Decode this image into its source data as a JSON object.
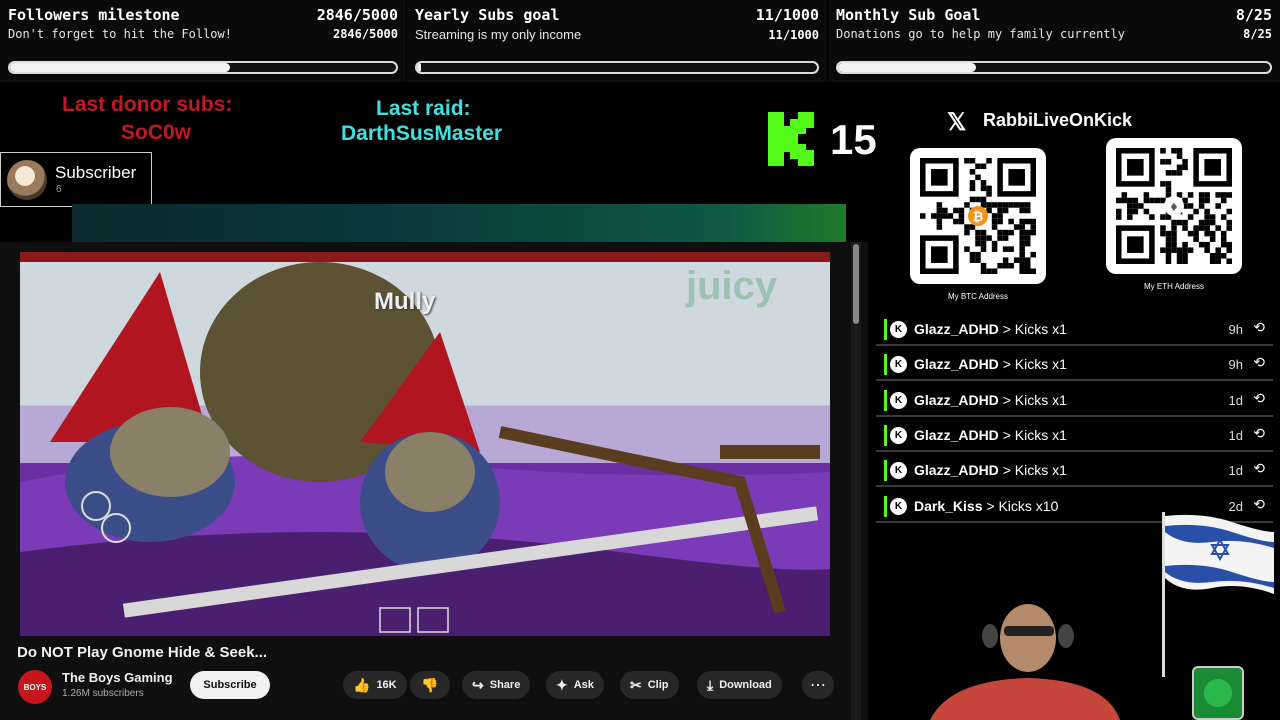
{
  "goals": [
    {
      "title": "Followers milestone",
      "subtitle": "Don't forget to hit the Follow!",
      "count": "2846/5000",
      "progress": 0.569
    },
    {
      "title": "Yearly Subs goal",
      "subtitle": "Streaming is my only income",
      "count": "11/1000",
      "progress": 0.011
    },
    {
      "title": "Monthly Sub Goal",
      "subtitle": "Donations go to help my family currently",
      "count": "8/25",
      "progress": 0.32
    }
  ],
  "donor": {
    "label": "Last donor subs:",
    "name": "SoC0w"
  },
  "raid": {
    "label": "Last raid:",
    "name": "DarthSusMaster"
  },
  "kick_count": "15",
  "subscriber_card": {
    "title": "Subscriber",
    "count": "6"
  },
  "video": {
    "overlay_text": "Mully",
    "watermark": "juicy",
    "title": "Do NOT Play Gnome Hide & Seek...",
    "channel": "The Boys Gaming",
    "channel_avatar_text": "BOYS",
    "subscribers": "1.26M subscribers",
    "subscribe_label": "Subscribe",
    "likes": "16K",
    "share_label": "Share",
    "ask_label": "Ask",
    "clip_label": "Clip",
    "download_label": "Download"
  },
  "social": {
    "handle": "RabbiLiveOnKick"
  },
  "qr": [
    {
      "label": "My BTC Address",
      "coin_color": "#f7931a"
    },
    {
      "label": "My ETH Address",
      "coin_color": "#8c8c8c"
    }
  ],
  "events": [
    {
      "user": "Glazz_ADHD",
      "action": "> Kicks x1",
      "time": "9h"
    },
    {
      "user": "Glazz_ADHD",
      "action": "> Kicks x1",
      "time": "9h"
    },
    {
      "user": "Glazz_ADHD",
      "action": "> Kicks x1",
      "time": "1d"
    },
    {
      "user": "Glazz_ADHD",
      "action": "> Kicks x1",
      "time": "1d"
    },
    {
      "user": "Glazz_ADHD",
      "action": "> Kicks x1",
      "time": "1d"
    },
    {
      "user": "Dark_Kiss",
      "action": "> Kicks x10",
      "time": "2d"
    }
  ],
  "colors": {
    "kick_green": "#53fc18",
    "donor_red": "#c0191f",
    "raid_cyan": "#3fe0df"
  }
}
